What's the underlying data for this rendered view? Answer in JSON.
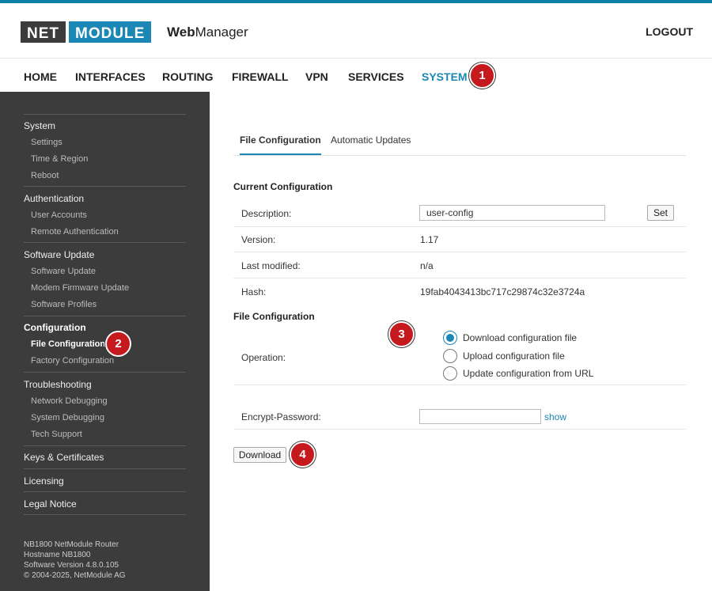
{
  "header": {
    "logo_net": "NET",
    "logo_module": "MODULE",
    "app_bold": "Web",
    "app_rest": "Manager",
    "logout": "LOGOUT"
  },
  "nav": {
    "items": [
      "HOME",
      "INTERFACES",
      "ROUTING",
      "FIREWALL",
      "VPN",
      "SERVICES",
      "SYSTEM"
    ],
    "active": "SYSTEM"
  },
  "badges": [
    "1",
    "2",
    "3",
    "4"
  ],
  "sidebar": {
    "groups": [
      {
        "title": "System",
        "items": [
          "Settings",
          "Time & Region",
          "Reboot"
        ]
      },
      {
        "title": "Authentication",
        "items": [
          "User Accounts",
          "Remote Authentication"
        ]
      },
      {
        "title": "Software Update",
        "items": [
          "Software Update",
          "Modem Firmware Update",
          "Software Profiles"
        ]
      },
      {
        "title": "Configuration",
        "items": [
          "File Configuration",
          "Factory Configuration"
        ]
      },
      {
        "title": "Troubleshooting",
        "items": [
          "Network Debugging",
          "System Debugging",
          "Tech Support"
        ]
      },
      {
        "title": "Keys & Certificates",
        "items": []
      },
      {
        "title": "Licensing",
        "items": []
      },
      {
        "title": "Legal Notice",
        "items": []
      }
    ],
    "active_item": "File Configuration",
    "footer": [
      "NB1800 NetModule Router",
      "Hostname NB1800",
      "Software Version 4.8.0.105",
      "© 2004-2025, NetModule AG"
    ]
  },
  "tabs": [
    "File Configuration",
    "Automatic Updates"
  ],
  "current": {
    "title": "Current Configuration",
    "description_label": "Description:",
    "description_value": "user-config",
    "set_button": "Set",
    "version_label": "Version:",
    "version_value": "1.17",
    "modified_label": "Last modified:",
    "modified_value": "n/a",
    "hash_label": "Hash:",
    "hash_value": "19fab4043413bc717c29874c32e3724a"
  },
  "file_config": {
    "title": "File Configuration",
    "operation_label": "Operation:",
    "options": [
      "Download configuration file",
      "Upload configuration file",
      "Update configuration from URL"
    ],
    "selected": "Download configuration file",
    "password_label": "Encrypt-Password:",
    "password_value": "",
    "show_link": "show",
    "download_button": "Download"
  },
  "colors": {
    "accent": "#1a87b4",
    "sidebar_bg": "#3c3c3c",
    "badge": "#c6191e"
  }
}
